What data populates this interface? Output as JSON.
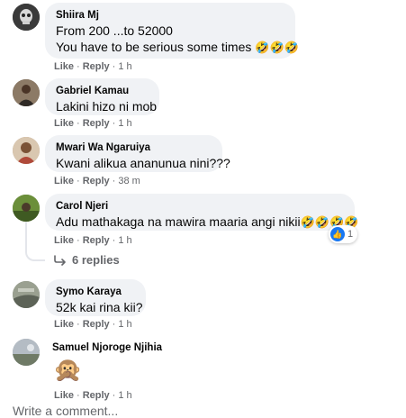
{
  "comments": [
    {
      "author": "Shiira Mj",
      "lines": [
        "From 200 ...to 52000",
        "You have to be serious some times"
      ],
      "emoji": "🤣🤣🤣",
      "like": "Like",
      "reply": "Reply",
      "time": "1 h",
      "avatar_color": "#2b2b2b"
    },
    {
      "author": "Gabriel Kamau",
      "lines": [
        "Lakini hizo ni mob"
      ],
      "like": "Like",
      "reply": "Reply",
      "time": "1 h",
      "avatar_color": "#6b5a4a"
    },
    {
      "author": "Mwari Wa Ngaruiya",
      "lines": [
        "Kwani alikua ananunua nini???"
      ],
      "like": "Like",
      "reply": "Reply",
      "time": "38 m",
      "avatar_color": "#b89a7a"
    },
    {
      "author": "Carol Njeri",
      "lines": [
        "Adu mathakaga na mawira maaria angi nikii"
      ],
      "emoji": "🤣🤣🤣🤣",
      "like": "Like",
      "reply": "Reply",
      "time": "1 h",
      "avatar_color": "#5f7a3a",
      "reactions": "1",
      "replies": "6 replies"
    },
    {
      "author": "Symo Karaya",
      "lines": [
        "52k kai rina kii?"
      ],
      "like": "Like",
      "reply": "Reply",
      "time": "1 h",
      "avatar_color": "#8a8f85"
    },
    {
      "author": "Samuel Njoroge Njihia",
      "sticker": "🙊",
      "like": "Like",
      "reply": "Reply",
      "time": "1 h",
      "avatar_color": "#9aa0a6"
    }
  ],
  "write_placeholder": "Write a comment...",
  "colors": {
    "bubble": "#f0f2f5",
    "meta": "#65676b",
    "like_blue": "#1877f2"
  }
}
